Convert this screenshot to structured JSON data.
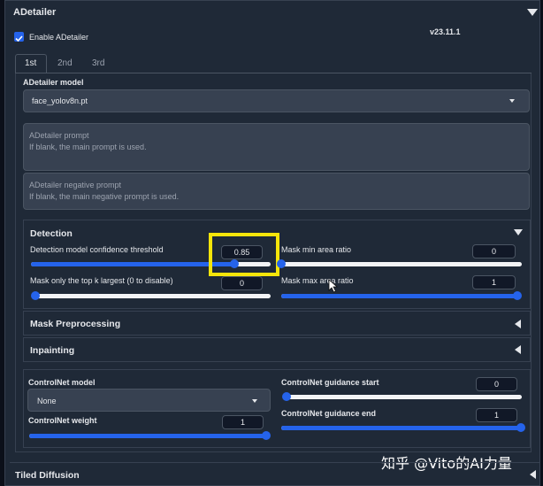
{
  "accordion": {
    "title": "ADetailer"
  },
  "enable": {
    "label": "Enable ADetailer",
    "checked": true
  },
  "version": "v23.11.1",
  "tabs": [
    {
      "label": "1st",
      "active": true
    },
    {
      "label": "2nd"
    },
    {
      "label": "3rd"
    }
  ],
  "model": {
    "label": "ADetailer model",
    "value": "face_yolov8n.pt"
  },
  "prompt": {
    "label": "ADetailer prompt",
    "placeholder": "If blank, the main prompt is used."
  },
  "neg_prompt": {
    "label": "ADetailer negative prompt",
    "placeholder": "If blank, the main negative prompt is used."
  },
  "detection": {
    "title": "Detection",
    "confidence": {
      "label": "Detection model confidence threshold",
      "value": "0.85",
      "fraction": 0.85
    },
    "mask_min": {
      "label": "Mask min area ratio",
      "value": "0",
      "fraction": 0
    },
    "top_k": {
      "label": "Mask only the top k largest (0 to disable)",
      "value": "0",
      "fraction": 0
    },
    "mask_max": {
      "label": "Mask max area ratio",
      "value": "1",
      "fraction": 1
    }
  },
  "mask_preprocessing": {
    "title": "Mask Preprocessing"
  },
  "inpainting": {
    "title": "Inpainting"
  },
  "controlnet": {
    "model": {
      "label": "ControlNet model",
      "value": "None"
    },
    "weight": {
      "label": "ControlNet weight",
      "value": "1",
      "fraction": 1
    },
    "guidance_start": {
      "label": "ControlNet guidance start",
      "value": "0",
      "fraction": 0
    },
    "guidance_end": {
      "label": "ControlNet guidance end",
      "value": "1",
      "fraction": 1
    }
  },
  "tiled": {
    "title": "Tiled Diffusion"
  },
  "watermark": "知乎 @Vito的AI力量",
  "colors": {
    "accent": "#2563eb",
    "highlight": "#f5e50a",
    "panel": "#1f2937"
  }
}
